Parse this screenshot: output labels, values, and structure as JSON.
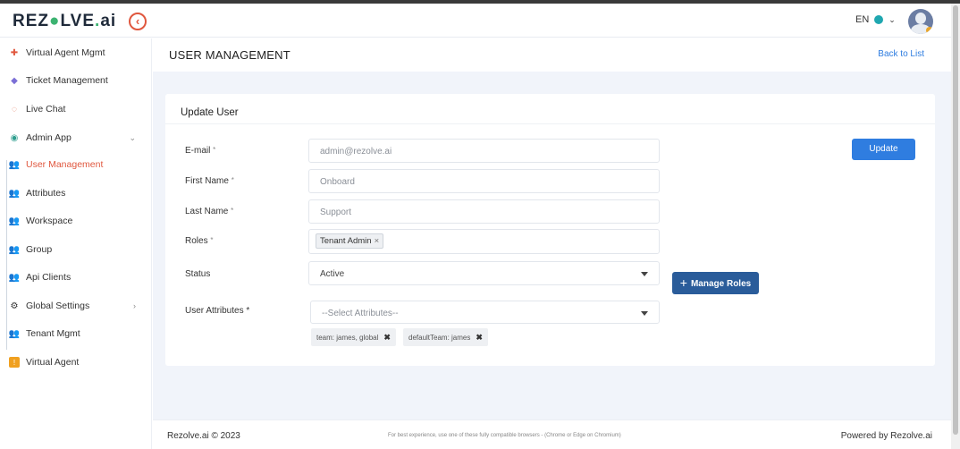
{
  "app": {
    "logo_text": "REZOLVE.ai",
    "language": "EN",
    "colors": {
      "accent": "#e0573e",
      "primary": "#2f7de0",
      "manage_roles": "#2a5c9a",
      "logo_dot": "#3cb371"
    }
  },
  "sidebar": {
    "items": [
      {
        "label": "Virtual Agent Mgmt",
        "icon": "puzzle-icon"
      },
      {
        "label": "Ticket Management",
        "icon": "ticket-icon"
      },
      {
        "label": "Live Chat",
        "icon": "chat-icon"
      },
      {
        "label": "Admin App",
        "icon": "admin-icon",
        "expanded": true
      },
      {
        "label": "User Management",
        "icon": "users-icon",
        "active": true
      },
      {
        "label": "Attributes",
        "icon": "users-icon"
      },
      {
        "label": "Workspace",
        "icon": "users-icon"
      },
      {
        "label": "Group",
        "icon": "users-icon"
      },
      {
        "label": "Api Clients",
        "icon": "users-icon"
      },
      {
        "label": "Global Settings",
        "icon": "gears-icon"
      },
      {
        "label": "Tenant Mgmt",
        "icon": "users-icon"
      },
      {
        "label": "Virtual Agent",
        "icon": "agent-icon"
      }
    ]
  },
  "page": {
    "title": "USER MANAGEMENT",
    "back_link": "Back to List"
  },
  "form": {
    "card_title": "Update User",
    "email_label": "E-mail",
    "email_value": "admin@rezolve.ai",
    "first_name_label": "First Name",
    "first_name_value": "Onboard",
    "last_name_label": "Last Name",
    "last_name_value": "Support",
    "roles_label": "Roles",
    "roles_chip": "Tenant Admin",
    "status_label": "Status",
    "status_value": "Active",
    "attributes_label": "User Attributes *",
    "attributes_placeholder": "--Select Attributes--",
    "attribute_chips": [
      "team: james, global",
      "defaultTeam: james"
    ],
    "required_mark": "*",
    "update_button": "Update",
    "manage_roles_button": "Manage Roles"
  },
  "footer": {
    "copyright": "Rezolve.ai © 2023",
    "browser_note": "For best experience, use one of these fully compatible browsers - (Chrome or Edge on Chromium)",
    "powered_by": "Powered by Rezolve.ai"
  }
}
